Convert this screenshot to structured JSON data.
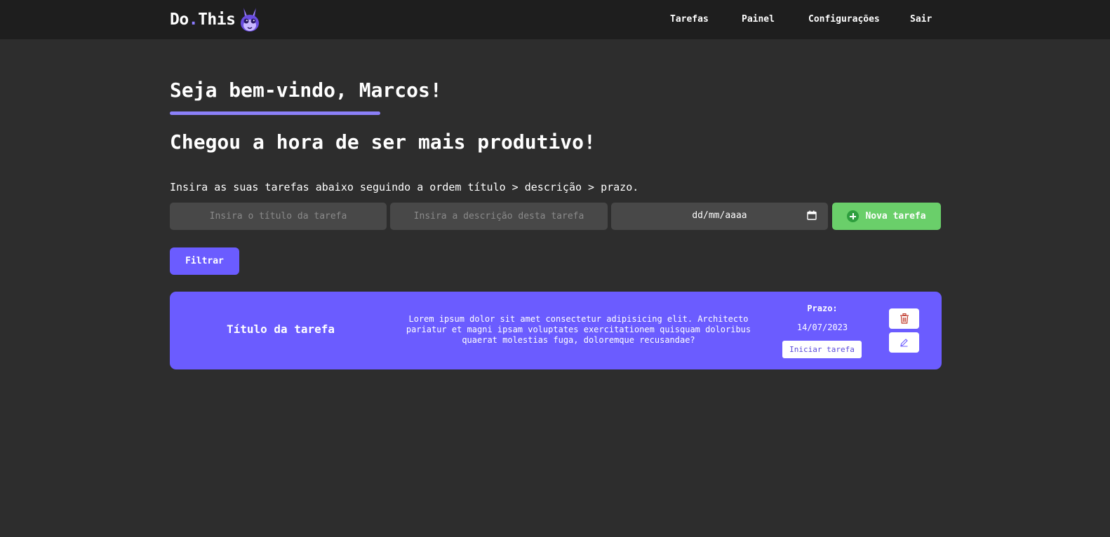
{
  "navbar": {
    "logo_text_part1": "Do",
    "logo_dot": ".",
    "logo_text_part2": "This",
    "links": [
      {
        "label": "Tarefas"
      },
      {
        "label": "Painel"
      },
      {
        "label": "Configurações"
      },
      {
        "label": "Sair"
      }
    ]
  },
  "header": {
    "welcome": "Seja bem-vindo, Marcos!",
    "subtitle": "Chegou a hora de ser mais produtivo!"
  },
  "form": {
    "instructions": "Insira as suas tarefas abaixo seguindo a ordem título > descrição > prazo.",
    "title_placeholder": "Insira o título da tarefa",
    "description_placeholder": "Insira a descrição desta tarefa",
    "date_placeholder": "dd/mm/aaaa",
    "new_task_label": "Nova tarefa",
    "filter_label": "Filtrar"
  },
  "tasks": [
    {
      "title": "Título da tarefa",
      "description": "Lorem ipsum dolor sit amet consectetur adipisicing elit. Architecto pariatur et magni ipsam voluptates exercitationem quisquam doloribus quaerat molestias fuga, doloremque recusandae?",
      "deadline_label": "Prazo:",
      "deadline": "14/07/2023",
      "start_label": "Iniciar tarefa"
    }
  ],
  "colors": {
    "background": "#2d2d2d",
    "navbar": "#1e1e1e",
    "accent": "#6b5cff",
    "success": "#6acf6a",
    "input_bg": "#484848",
    "delete_icon": "#c0392b"
  },
  "icons": {
    "logo": "bunny-mascot-icon",
    "calendar": "calendar-icon",
    "add": "plus-circle-icon",
    "delete": "trash-icon",
    "edit": "pencil-icon"
  }
}
